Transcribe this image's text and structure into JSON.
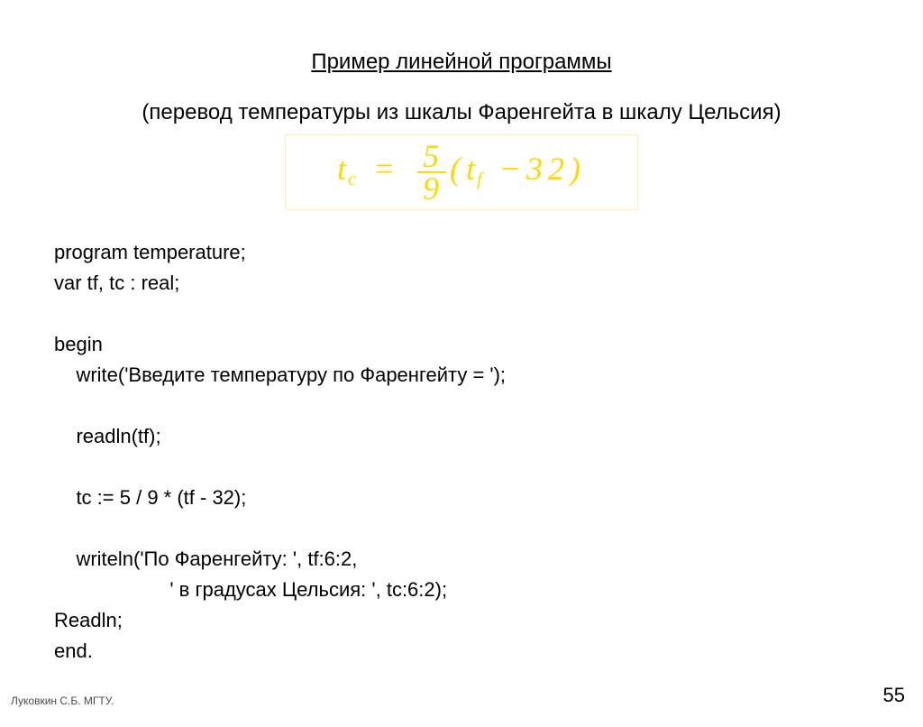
{
  "title": "Пример линейной программы",
  "subtitle": "(перевод температуры из шкалы Фаренгейта в шкалу Цельсия)",
  "formula": {
    "lhs_var": "t",
    "lhs_sub": "c",
    "eq": "=",
    "frac_num": "5",
    "frac_den": "9",
    "open": "(",
    "rhs_var": "t",
    "rhs_sub": "f",
    "minus": "−",
    "const": "32",
    "close": ")"
  },
  "code_lines": {
    "l1": "program temperature;",
    "l2": "var tf, tc : real;",
    "l3": "",
    "l4": "begin",
    "l5": "    write('Введите температуру по Фаренгейту = ');",
    "l6": "",
    "l7": "    readln(tf);",
    "l8": "",
    "l9": "    tc := 5 / 9 * (tf - 32);",
    "l10": "",
    "l11": "    writeln('По Фаренгейту: ', tf:6:2,",
    "l12": "                     ' в градусах Цельсия: ', tc:6:2);",
    "l13": "Readln;",
    "l14": "end."
  },
  "footer": {
    "author": "Луковкин С.Б. МГТУ.",
    "page": "55"
  }
}
